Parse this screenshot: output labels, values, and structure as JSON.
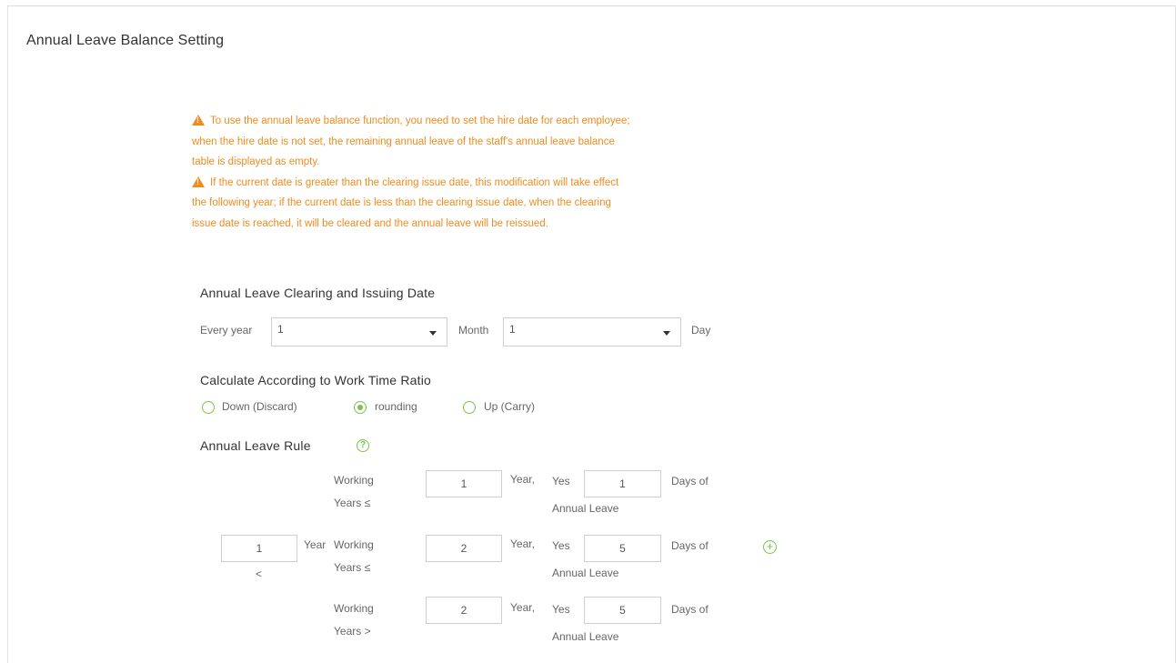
{
  "page": {
    "title": "Annual Leave Balance Setting"
  },
  "notice": {
    "lines_1": [
      "To use the annual leave balance function, you need to set the hire date for each employee;",
      "when the hire date is not set, the remaining annual leave of the staff's annual leave balance",
      "table is displayed as empty."
    ],
    "lines_2": [
      "If the current date is greater than the clearing issue date, this modification will take effect",
      "the following year; if the current date is less than the clearing issue date, when the clearing",
      "issue date is reached, it will be cleared and the annual leave will be reissued."
    ],
    "color": "#f08b1d"
  },
  "clearing": {
    "title": "Annual Leave Clearing and Issuing Date",
    "every_year_label": "Every year",
    "month_value": "1",
    "month_label": "Month",
    "day_value": "1",
    "day_label": "Day"
  },
  "ratio": {
    "title": "Calculate According to Work Time Ratio",
    "options": [
      {
        "label": "Down (Discard)",
        "checked": false
      },
      {
        "label": "rounding",
        "checked": true
      },
      {
        "label": "Up (Carry)",
        "checked": false
      }
    ],
    "accent": "#7cc34a"
  },
  "rule": {
    "title": "Annual Leave Rule",
    "help_icon": "question-circle-icon",
    "add_icon": "plus-circle-icon",
    "rows": [
      {
        "from_value": null,
        "from_suffix": null,
        "lt_symbol": null,
        "working": "Working",
        "years_cmp": "Years ≤",
        "years_value": "1",
        "year_label": "Year,",
        "yes_label": "Yes",
        "days_value": "1",
        "days_of": "Days of",
        "annual_leave": "Annual Leave"
      },
      {
        "from_value": "1",
        "from_suffix": "Year",
        "lt_symbol": "<",
        "working": "Working",
        "years_cmp": "Years ≤",
        "years_value": "2",
        "year_label": "Year,",
        "yes_label": "Yes",
        "days_value": "5",
        "days_of": "Days of",
        "annual_leave": "Annual Leave"
      },
      {
        "from_value": null,
        "from_suffix": null,
        "lt_symbol": null,
        "working": "Working",
        "years_cmp": "Years >",
        "years_value": "2",
        "year_label": "Year,",
        "yes_label": "Yes",
        "days_value": "5",
        "days_of": "Days of",
        "annual_leave": "Annual Leave"
      }
    ]
  }
}
